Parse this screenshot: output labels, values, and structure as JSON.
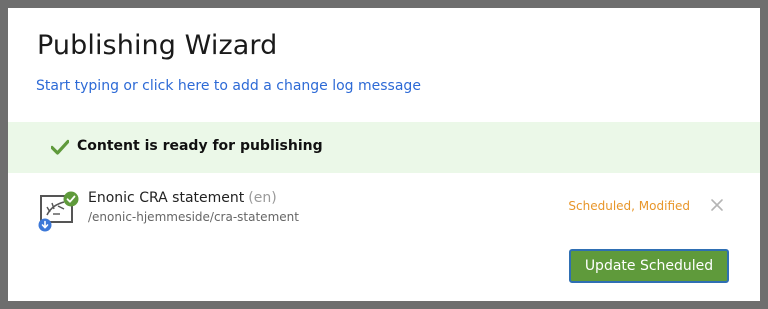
{
  "dialog": {
    "title": "Publishing Wizard",
    "changelog_prompt": "Start typing or click here to add a change log message"
  },
  "status": {
    "message": "Content is ready for publishing",
    "icon": "checkmark-icon",
    "color": "#5f9a3b",
    "background": "#ebf8e8"
  },
  "items": [
    {
      "name": "Enonic CRA statement",
      "language": "(en)",
      "path": "/enonic-hjemmeside/cra-statement",
      "status": "Scheduled, Modified",
      "status_color": "#e8962a",
      "icon": "content-document-icon",
      "remove_icon": "close-icon"
    }
  ],
  "actions": {
    "update_label": "Update Scheduled",
    "update_color": "#5f9a3b"
  }
}
